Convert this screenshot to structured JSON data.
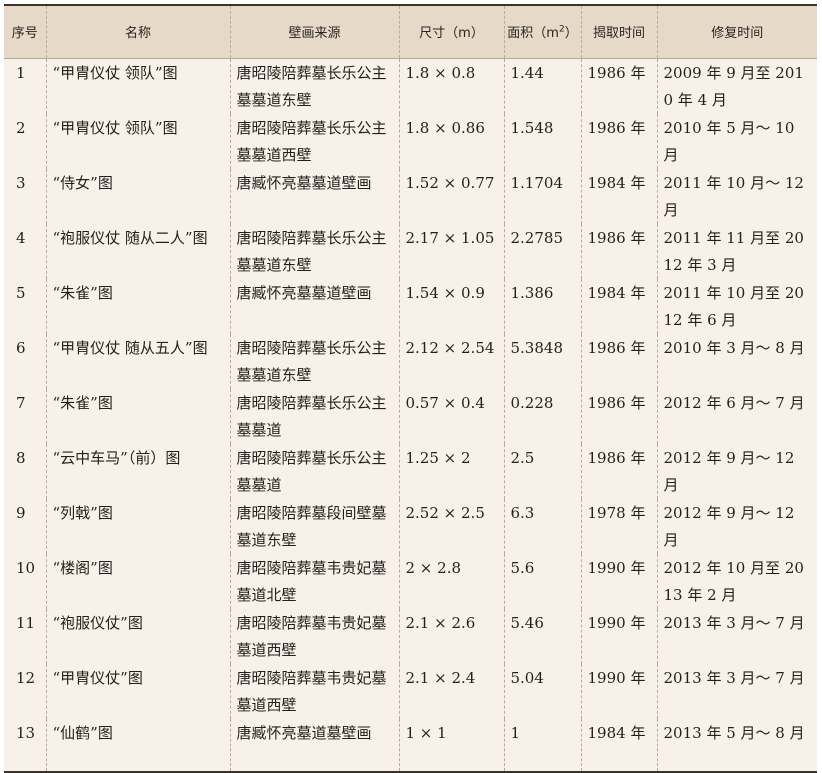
{
  "table": {
    "headers": {
      "index": "序号",
      "name": "名称",
      "source": "壁画来源",
      "size": "尺寸（m）",
      "area_prefix": "面积（m",
      "area_sup": "2",
      "area_suffix": "）",
      "removal_time": "揭取时间",
      "restoration_time": "修复时间"
    },
    "rows": [
      {
        "index": "1",
        "name": "“甲胄仪仗 领队”图",
        "source": "唐昭陵陪葬墓长乐公主墓墓道东壁",
        "size": "1.8 × 0.8",
        "area": "1.44",
        "removal_time": "1986 年",
        "restoration_time": "2009 年 9 月至 2010 年 4 月"
      },
      {
        "index": "2",
        "name": "“甲胄仪仗 领队”图",
        "source": "唐昭陵陪葬墓长乐公主墓墓道西壁",
        "size": "1.8 × 0.86",
        "area": "1.548",
        "removal_time": "1986 年",
        "restoration_time": "2010 年 5 月～ 10 月"
      },
      {
        "index": "3",
        "name": "“侍女”图",
        "source": "唐臧怀亮墓墓道壁画",
        "size": "1.52 × 0.77",
        "area": "1.1704",
        "removal_time": "1984 年",
        "restoration_time": "2011 年 10 月～ 12 月"
      },
      {
        "index": "4",
        "name": "“袍服仪仗 随从二人”图",
        "source": "唐昭陵陪葬墓长乐公主墓墓道东壁",
        "size": "2.17 × 1.05",
        "area": "2.2785",
        "removal_time": "1986 年",
        "restoration_time": "2011 年 11 月至 2012 年 3 月"
      },
      {
        "index": "5",
        "name": "“朱雀”图",
        "source": "唐臧怀亮墓墓道壁画",
        "size": "1.54 × 0.9",
        "area": "1.386",
        "removal_time": "1984 年",
        "restoration_time": "2011 年 10 月至 2012 年 6 月"
      },
      {
        "index": "6",
        "name": "“甲胄仪仗 随从五人”图",
        "source": "唐昭陵陪葬墓长乐公主墓墓道东壁",
        "size": "2.12 × 2.54",
        "area": "5.3848",
        "removal_time": "1986 年",
        "restoration_time": "2010 年 3 月～ 8 月"
      },
      {
        "index": "7",
        "name": "“朱雀”图",
        "source": "唐昭陵陪葬墓长乐公主墓墓道",
        "size": "0.57 × 0.4",
        "area": "0.228",
        "removal_time": "1986 年",
        "restoration_time": "2012 年 6 月～ 7 月"
      },
      {
        "index": "8",
        "name": "“云中车马”（前）图",
        "source": "唐昭陵陪葬墓长乐公主墓墓道",
        "size": "1.25 × 2",
        "area": "2.5",
        "removal_time": "1986 年",
        "restoration_time": "2012 年 9 月～ 12 月"
      },
      {
        "index": "9",
        "name": "“列戟”图",
        "source": "唐昭陵陪葬墓段间壁墓墓道东壁",
        "size": "2.52 × 2.5",
        "area": "6.3",
        "removal_time": "1978 年",
        "restoration_time": "2012 年 9 月～ 12 月"
      },
      {
        "index": "10",
        "name": "“楼阁”图",
        "source": "唐昭陵陪葬墓韦贵妃墓墓道北壁",
        "size": "2 × 2.8",
        "area": "5.6",
        "removal_time": "1990 年",
        "restoration_time": "2012 年 10 月至 2013 年 2 月"
      },
      {
        "index": "11",
        "name": "“袍服仪仗”图",
        "source": "唐昭陵陪葬墓韦贵妃墓墓道西壁",
        "size": "2.1 × 2.6",
        "area": "5.46",
        "removal_time": "1990 年",
        "restoration_time": "2013 年 3 月～ 7 月"
      },
      {
        "index": "12",
        "name": "“甲胄仪仗”图",
        "source": "唐昭陵陪葬墓韦贵妃墓墓道西壁",
        "size": "2.1 × 2.4",
        "area": "5.04",
        "removal_time": "1990 年",
        "restoration_time": "2013 年 3 月～ 7 月"
      },
      {
        "index": "13",
        "name": "“仙鹤”图",
        "source": "唐臧怀亮墓道墓壁画",
        "size": "1 × 1",
        "area": "1",
        "removal_time": "1984 年",
        "restoration_time": "2013 年 5 月～ 8 月"
      }
    ]
  }
}
